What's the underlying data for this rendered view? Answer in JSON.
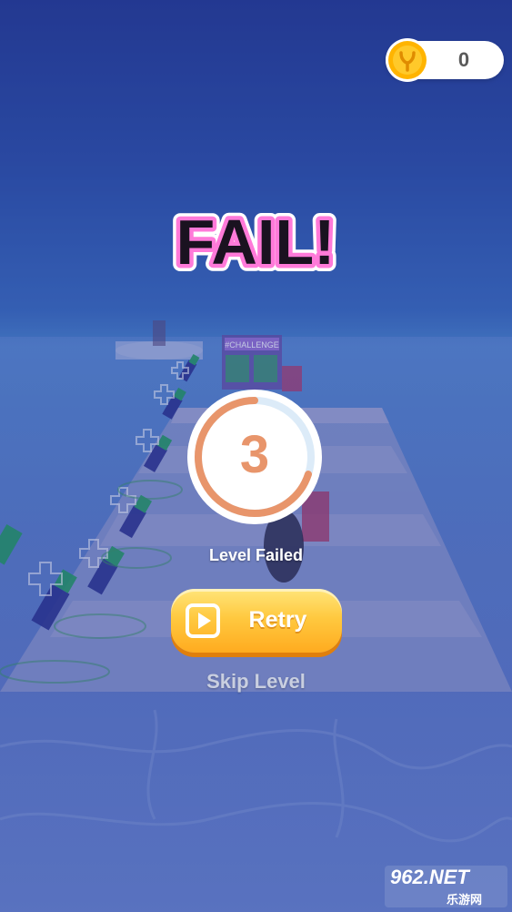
{
  "hud": {
    "coin_count": "0",
    "coin_icon": "coin-icon"
  },
  "result": {
    "title": "FAIL!",
    "countdown": "3",
    "countdown_progress": 0.7,
    "status_text": "Level Failed"
  },
  "actions": {
    "retry_label": "Retry",
    "retry_icon": "play-video-icon",
    "skip_label": "Skip Level"
  },
  "scene": {
    "billboard_text": "#CHALLENGE"
  },
  "watermark": {
    "top": "962.NET",
    "bottom": "乐游网"
  },
  "colors": {
    "fail_text": "#1a1220",
    "fail_outline_pink": "#ff7ad9",
    "countdown_ring": "#e8956b",
    "retry_button": "#ffc940",
    "coin": "#ffb400"
  }
}
